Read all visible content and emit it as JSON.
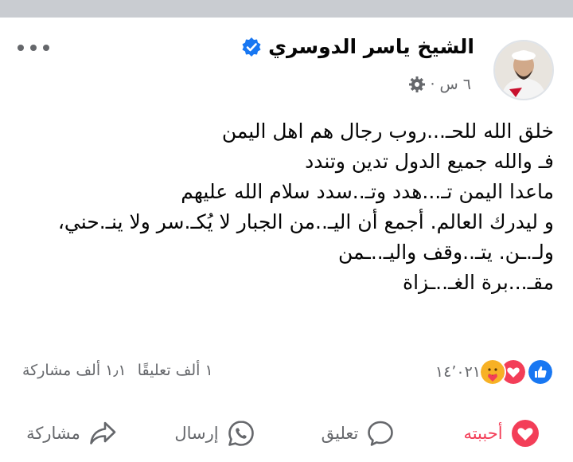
{
  "post": {
    "author": "الشيخ ياسر الدوسري",
    "timestamp": "٦ س",
    "separator": "·",
    "privacy_icon": "settings-gear-icon",
    "lines": [
      "خلق الله للحـ...روب رجال هم اهل اليمن",
      "فـ والله  جميع الدول  تدين وتندد",
      "ماعدا اليمن تـ...هدد وتـ..سدد سلام الله عليهم",
      "و ليدرك العالم. أجمع أن اليـ..من الجبار لا يُكـ.سر ولا ينـ.حني،",
      "ولـ.ـن. يتـ..وقف واليـ..ـمن",
      "مقـ...برة الغـ..ـزاة"
    ]
  },
  "reactions": {
    "count": "١٤٬٠٢١",
    "types": [
      "like-reaction-icon",
      "love-reaction-icon",
      "care-reaction-icon"
    ],
    "colors": {
      "like": "#1877f2",
      "love": "#f33e58",
      "care": "#f7b125"
    }
  },
  "stats": {
    "comments": "١ ألف تعليقًا",
    "shares": "١٫١ ألف مشاركة"
  },
  "actions": {
    "like": "أحببته",
    "comment": "تعليق",
    "send": "إرسال",
    "share": "مشاركة"
  }
}
